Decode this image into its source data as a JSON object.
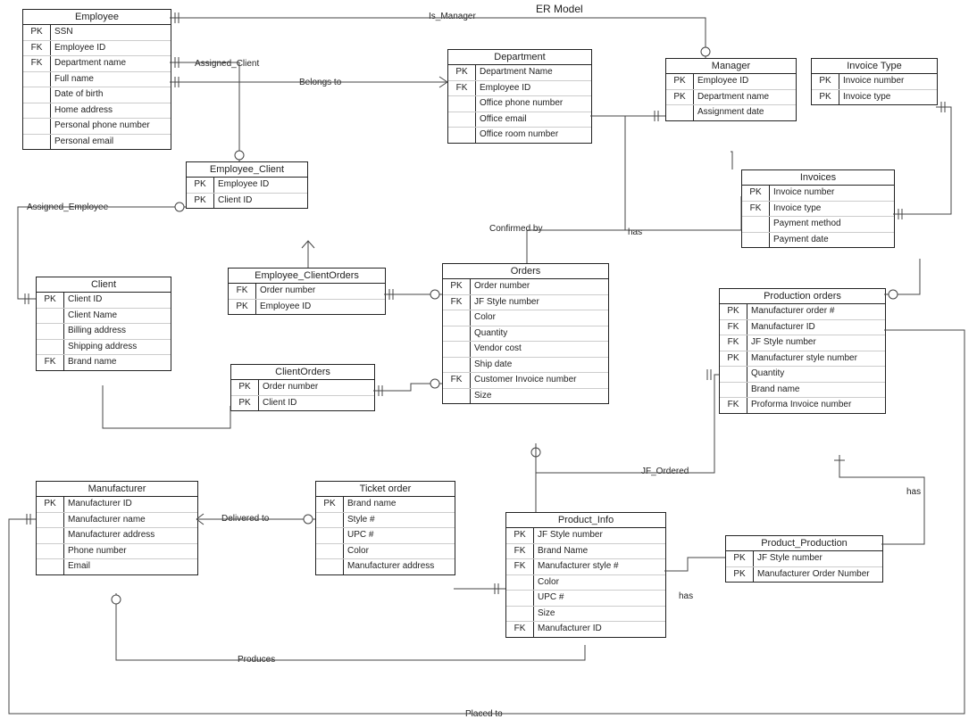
{
  "diagram_title": "ER Model",
  "relationships": {
    "is_manager": "Is_Manager",
    "assigned_client": "Assigned_Client",
    "belongs_to": "Belongs to",
    "assigned_employee": "Assigned_Employee",
    "confirmed_by": "Confirmed by",
    "has1": "has",
    "jf_ordered": "JF_Ordered",
    "delivered_to": "Delivered to",
    "produces": "Produces",
    "placed_to": "Placed to",
    "has2": "has",
    "has3": "has"
  },
  "entities": {
    "employee": {
      "name": "Employee",
      "rows": [
        {
          "key": "PK",
          "name": "SSN"
        },
        {
          "key": "FK",
          "name": "Employee ID"
        },
        {
          "key": "FK",
          "name": "Department name"
        },
        {
          "key": "",
          "name": "Full name"
        },
        {
          "key": "",
          "name": "Date of birth"
        },
        {
          "key": "",
          "name": "Home address"
        },
        {
          "key": "",
          "name": "Personal phone number"
        },
        {
          "key": "",
          "name": "Personal email"
        }
      ]
    },
    "department": {
      "name": "Department",
      "rows": [
        {
          "key": "PK",
          "name": "Department Name"
        },
        {
          "key": "FK",
          "name": "Employee ID"
        },
        {
          "key": "",
          "name": "Office phone number"
        },
        {
          "key": "",
          "name": "Office email"
        },
        {
          "key": "",
          "name": "Office room number"
        }
      ]
    },
    "manager": {
      "name": "Manager",
      "rows": [
        {
          "key": "PK",
          "name": "Employee ID"
        },
        {
          "key": "PK",
          "name": "Department name"
        },
        {
          "key": "",
          "name": "Assignment date"
        }
      ]
    },
    "invoice_type": {
      "name": "Invoice Type",
      "rows": [
        {
          "key": "PK",
          "name": "Invoice number"
        },
        {
          "key": "PK",
          "name": "Invoice type"
        }
      ]
    },
    "employee_client": {
      "name": "Employee_Client",
      "rows": [
        {
          "key": "PK",
          "name": "Employee ID"
        },
        {
          "key": "PK",
          "name": "Client ID"
        }
      ]
    },
    "invoices": {
      "name": "Invoices",
      "rows": [
        {
          "key": "PK",
          "name": "Invoice number"
        },
        {
          "key": "FK",
          "name": "Invoice type"
        },
        {
          "key": "",
          "name": "Payment method"
        },
        {
          "key": "",
          "name": "Payment date"
        }
      ]
    },
    "client": {
      "name": "Client",
      "rows": [
        {
          "key": "PK",
          "name": "Client ID"
        },
        {
          "key": "",
          "name": "Client Name"
        },
        {
          "key": "",
          "name": "Billing address"
        },
        {
          "key": "",
          "name": "Shipping address"
        },
        {
          "key": "FK",
          "name": "Brand name"
        }
      ]
    },
    "employee_clientorders": {
      "name": "Employee_ClientOrders",
      "rows": [
        {
          "key": "FK",
          "name": "Order number"
        },
        {
          "key": "PK",
          "name": "Employee ID"
        }
      ]
    },
    "orders": {
      "name": "Orders",
      "rows": [
        {
          "key": "PK",
          "name": "Order number"
        },
        {
          "key": "FK",
          "name": "JF Style number"
        },
        {
          "key": "",
          "name": "Color"
        },
        {
          "key": "",
          "name": "Quantity"
        },
        {
          "key": "",
          "name": "Vendor cost"
        },
        {
          "key": "",
          "name": "Ship date"
        },
        {
          "key": "FK",
          "name": "Customer Invoice number"
        },
        {
          "key": "",
          "name": "Size"
        }
      ]
    },
    "production_orders": {
      "name": "Production orders",
      "rows": [
        {
          "key": "PK",
          "name": "Manufacturer order #"
        },
        {
          "key": "FK",
          "name": "Manufacturer ID"
        },
        {
          "key": "FK",
          "name": "JF Style number"
        },
        {
          "key": "PK",
          "name": "Manufacturer style number"
        },
        {
          "key": "",
          "name": "Quantity"
        },
        {
          "key": "",
          "name": "Brand name"
        },
        {
          "key": "FK",
          "name": "Proforma Invoice number"
        }
      ]
    },
    "clientorders": {
      "name": "ClientOrders",
      "rows": [
        {
          "key": "PK",
          "name": "Order number"
        },
        {
          "key": "PK",
          "name": "Client ID"
        }
      ]
    },
    "manufacturer": {
      "name": "Manufacturer",
      "rows": [
        {
          "key": "PK",
          "name": "Manufacturer ID"
        },
        {
          "key": "",
          "name": "Manufacturer name"
        },
        {
          "key": "",
          "name": "Manufacturer address"
        },
        {
          "key": "",
          "name": "Phone number"
        },
        {
          "key": "",
          "name": "Email"
        }
      ]
    },
    "ticket_order": {
      "name": "Ticket order",
      "rows": [
        {
          "key": "PK",
          "name": "Brand name"
        },
        {
          "key": "",
          "name": "Style #"
        },
        {
          "key": "",
          "name": "UPC #"
        },
        {
          "key": "",
          "name": "Color"
        },
        {
          "key": "",
          "name": "Manufacturer address"
        }
      ]
    },
    "product_info": {
      "name": "Product_Info",
      "rows": [
        {
          "key": "PK",
          "name": "JF Style number"
        },
        {
          "key": "FK",
          "name": "Brand Name"
        },
        {
          "key": "FK",
          "name": "Manufacturer style #"
        },
        {
          "key": "",
          "name": "Color"
        },
        {
          "key": "",
          "name": "UPC #"
        },
        {
          "key": "",
          "name": "Size"
        },
        {
          "key": "FK",
          "name": "Manufacturer ID"
        }
      ]
    },
    "product_production": {
      "name": "Product_Production",
      "rows": [
        {
          "key": "PK",
          "name": "JF Style number"
        },
        {
          "key": "PK",
          "name": "Manufacturer Order Number"
        }
      ]
    }
  }
}
